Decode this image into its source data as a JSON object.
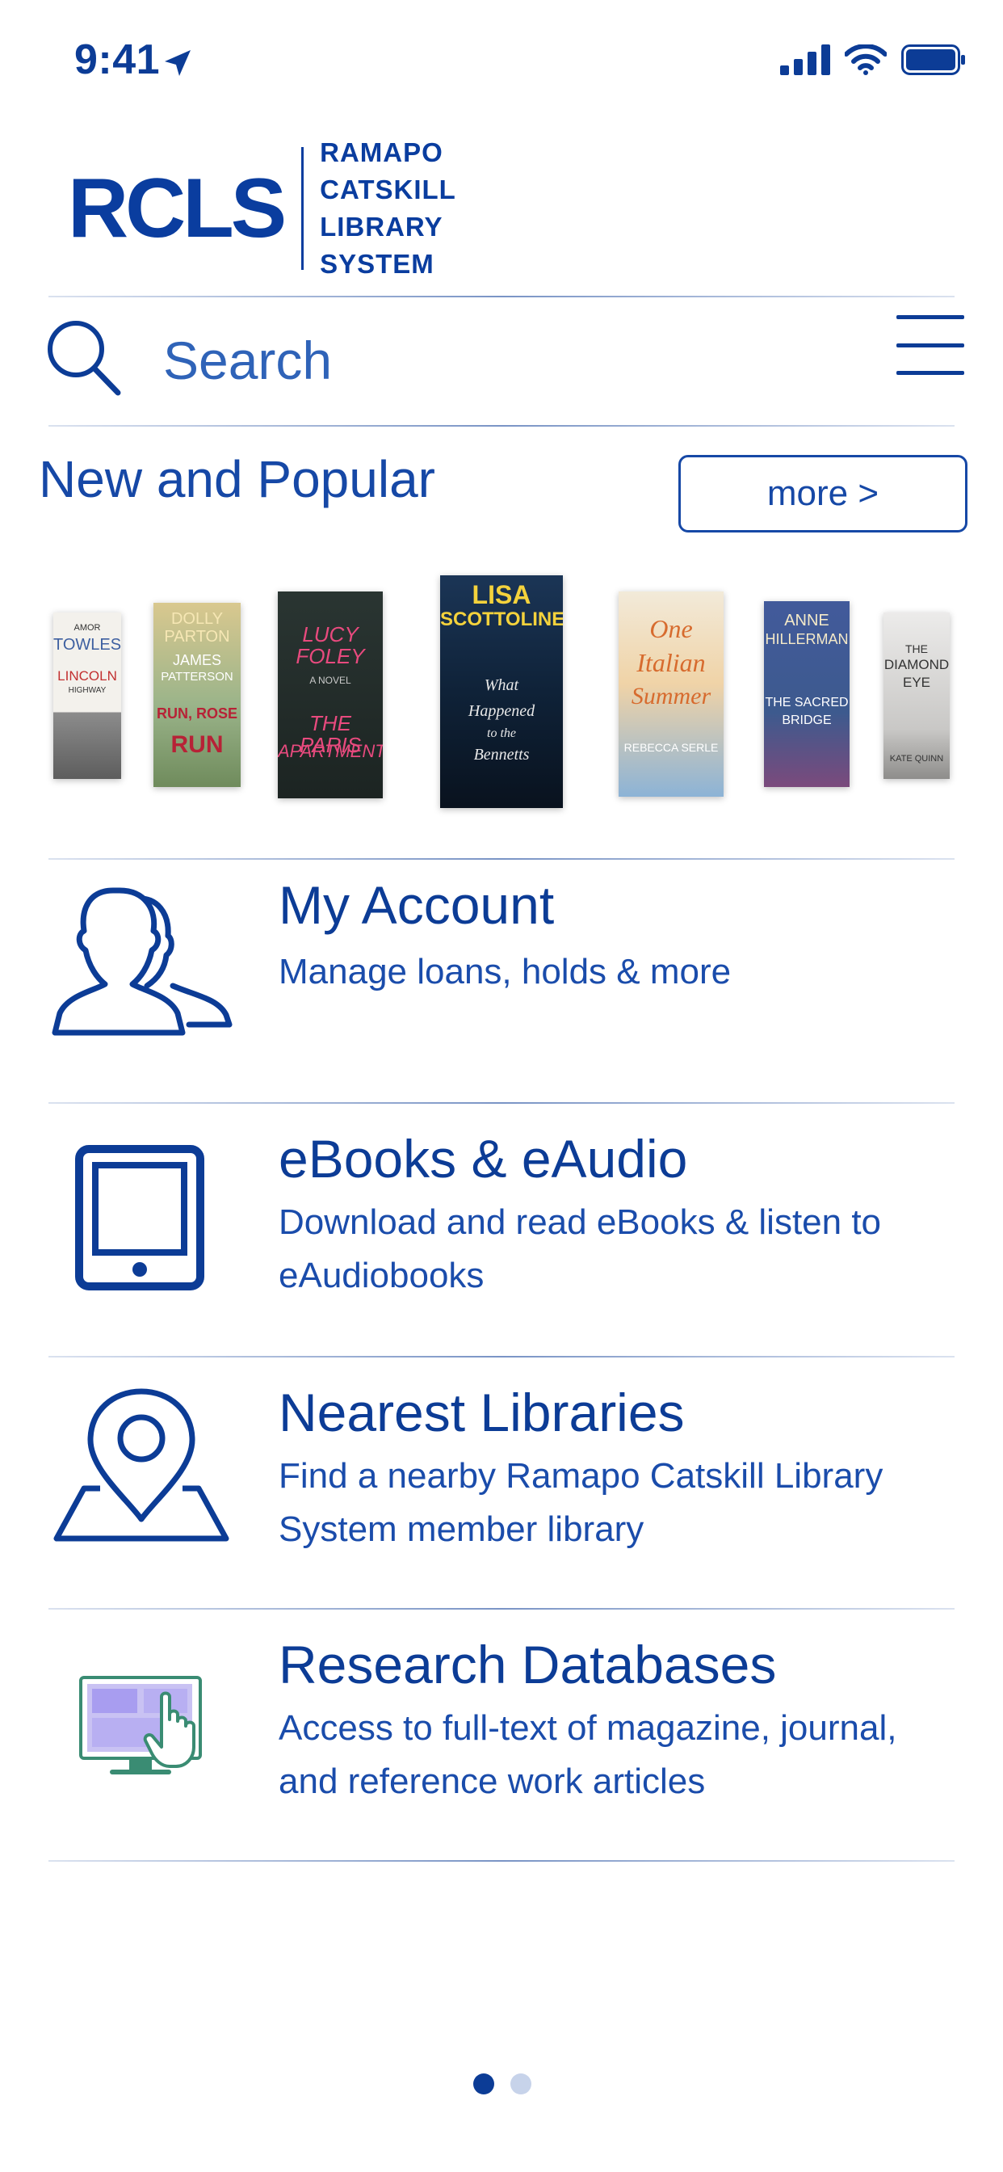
{
  "status_bar": {
    "time": "9:41",
    "icons": [
      "location-arrow-icon",
      "cellular-signal-icon",
      "wifi-icon",
      "battery-icon"
    ]
  },
  "logo": {
    "mark": "RCLS",
    "lines": [
      "RAMAPO",
      "CATSKILL",
      "LIBRARY",
      "SYSTEM"
    ]
  },
  "search": {
    "placeholder": "Search"
  },
  "new_popular": {
    "title": "New and Popular",
    "more_label": "more >",
    "books": [
      {
        "cover_text": [
          "AMOR",
          "TOWLES",
          "LINCOLN",
          "HIGHWAY"
        ]
      },
      {
        "cover_text": [
          "DOLLY",
          "PARTON",
          "JAMES",
          "PATTERSON",
          "RUN, ROSE",
          "RUN"
        ]
      },
      {
        "cover_text": [
          "LUCY FOLEY",
          "A NOVEL",
          "THE PARIS",
          "APARTMENT"
        ]
      },
      {
        "cover_text": [
          "LISA",
          "SCOTTOLINE",
          "What",
          "Happened",
          "to the",
          "Bennetts"
        ]
      },
      {
        "cover_text": [
          "One",
          "Italian",
          "Summer",
          "REBECCA SERLE"
        ]
      },
      {
        "cover_text": [
          "ANNE",
          "HILLERMAN",
          "THE SACRED",
          "BRIDGE"
        ]
      },
      {
        "cover_text": [
          "THE",
          "DIAMOND",
          "EYE",
          "KATE QUINN"
        ]
      }
    ]
  },
  "menu_items": [
    {
      "title": "My Account",
      "description": "Manage loans, holds & more",
      "icon": "users-icon"
    },
    {
      "title": "eBooks & eAudio",
      "description": "Download and read eBooks & listen to eAudiobooks",
      "icon": "tablet-icon"
    },
    {
      "title": "Nearest Libraries",
      "description": "Find a nearby Ramapo Catskill Library System member library",
      "icon": "map-pin-icon"
    },
    {
      "title": "Research Databases",
      "description": "Access to full-text of magazine, journal, and reference work articles",
      "icon": "computer-click-icon"
    }
  ],
  "pager": {
    "pages": 2,
    "current": 1
  },
  "colors": {
    "primary": "#0c3c96",
    "divider": "#c8d4ea",
    "dot_inactive": "#c7d3ea"
  }
}
